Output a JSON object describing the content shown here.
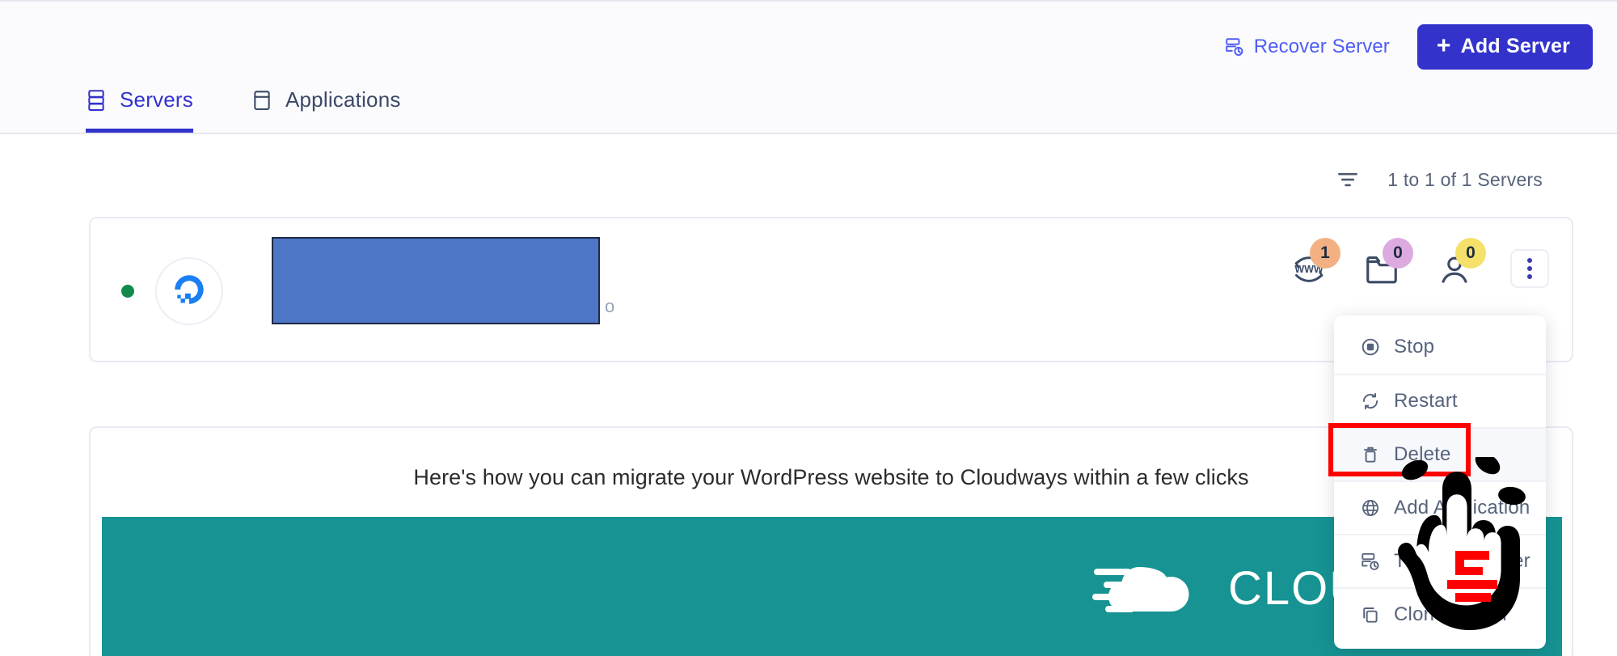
{
  "header": {
    "recover_label": "Recover Server",
    "recover_icon": "server-recover-icon",
    "add_label": "Add Server",
    "add_plus": "+",
    "tabs": [
      {
        "label": "Servers",
        "icon": "server-stack-icon",
        "active": true
      },
      {
        "label": "Applications",
        "icon": "window-panel-icon",
        "active": false
      }
    ]
  },
  "list_toolbar": {
    "filter_icon": "filter-icon",
    "count_text": "1 to 1 of 1 Servers"
  },
  "server_row": {
    "status": "online",
    "status_color": "#128a4d",
    "provider_icon": "digitalocean-logo-icon",
    "name_redacted": true,
    "redaction_color": "#4d76c6",
    "redaction_border": "#1e2a44",
    "trailing_text": "o",
    "badges": [
      {
        "icon": "www-globe-icon",
        "count": "1",
        "color": "#f3b183"
      },
      {
        "icon": "folder-icon",
        "count": "0",
        "color": "#dcaae0"
      },
      {
        "icon": "user-icon",
        "count": "0",
        "color": "#f5e06a"
      }
    ],
    "kebab_icon": "vertical-dots-icon"
  },
  "menu": {
    "items": [
      {
        "label": "Stop",
        "icon": "stop-circle-icon",
        "hovered": false
      },
      {
        "label": "Restart",
        "icon": "restart-icon",
        "hovered": false
      },
      {
        "label": "Delete",
        "icon": "trash-icon",
        "hovered": true
      },
      {
        "label": "Add Application",
        "icon": "globe-icon",
        "hovered": false
      },
      {
        "label": "Transfer Server",
        "icon": "transfer-server-icon",
        "hovered": false
      },
      {
        "label": "Clone Server",
        "icon": "clone-icon",
        "hovered": false
      }
    ],
    "highlight_color": "#ff0000",
    "highlighted_item": "Delete"
  },
  "promo": {
    "title": "Here's how you can migrate your WordPress website to Cloudways within a few clicks",
    "video_bg_color": "#169392",
    "logo_icon": "cloudways-cloud-icon",
    "logo_text": "CLOU"
  },
  "cursor": {
    "icon": "pointing-hand-cursor-icon",
    "glyph": "ㅌ",
    "glyph_color": "#ff0000"
  },
  "theme": {
    "accent": "#3333cc",
    "text": "#56637c",
    "header_bg": "#fbfbfd",
    "border": "#e9eaf3"
  }
}
